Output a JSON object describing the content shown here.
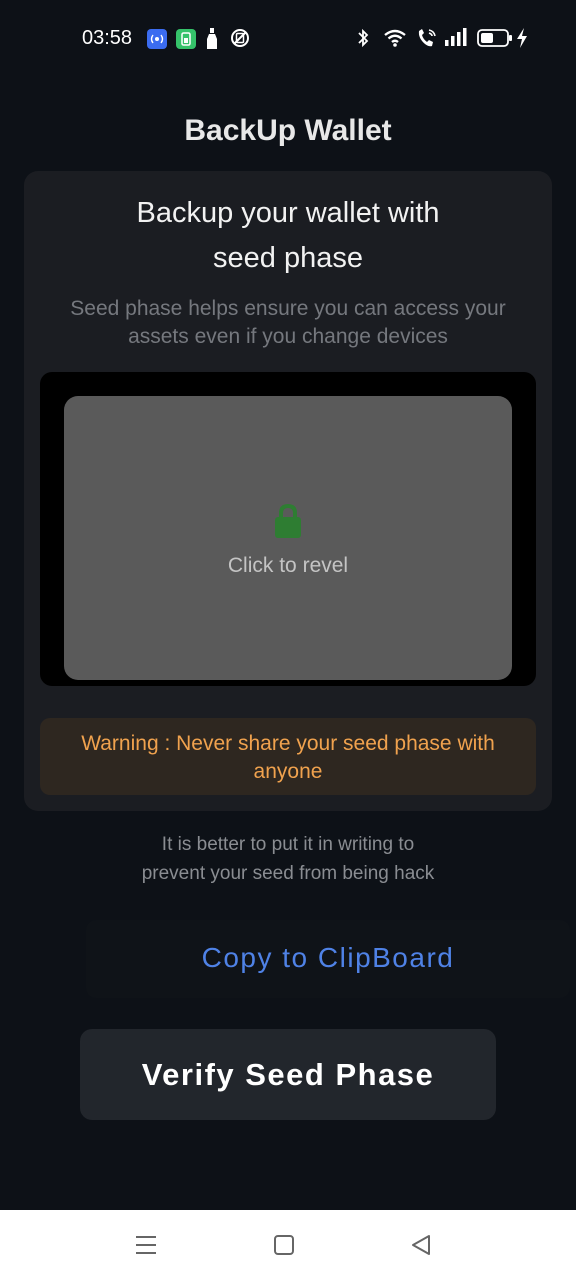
{
  "status_bar": {
    "time": "03:58",
    "left_icons": [
      "broadcast-icon",
      "battery-app-icon",
      "bottle-icon",
      "no-sim-icon"
    ],
    "right_icons": [
      "bluetooth-icon",
      "wifi-icon",
      "call-icon",
      "signal-icon",
      "battery-icon",
      "charging-icon"
    ]
  },
  "header": {
    "title": "BackUp Wallet"
  },
  "card": {
    "heading_line1": "Backup your wallet with",
    "heading_line2": "seed phase",
    "subtitle": "Seed phase helps ensure you can access your assets even if you change devices",
    "reveal": {
      "label": "Click to revel",
      "icon": "lock-icon"
    },
    "warning": "Warning : Never share your seed phase with anyone"
  },
  "hint": {
    "line1": "It is better to put it in writing to",
    "line2": "prevent your seed from being hack"
  },
  "buttons": {
    "copy": "Copy to ClipBoard",
    "verify": "Verify Seed Phase"
  },
  "nav": [
    "menu-icon",
    "home-icon",
    "back-icon"
  ],
  "colors": {
    "background": "#0d1117",
    "card": "#1b1d22",
    "warning_text": "#f0a24e",
    "link_blue": "#4f82e6",
    "lock_green": "#2e7d32"
  }
}
